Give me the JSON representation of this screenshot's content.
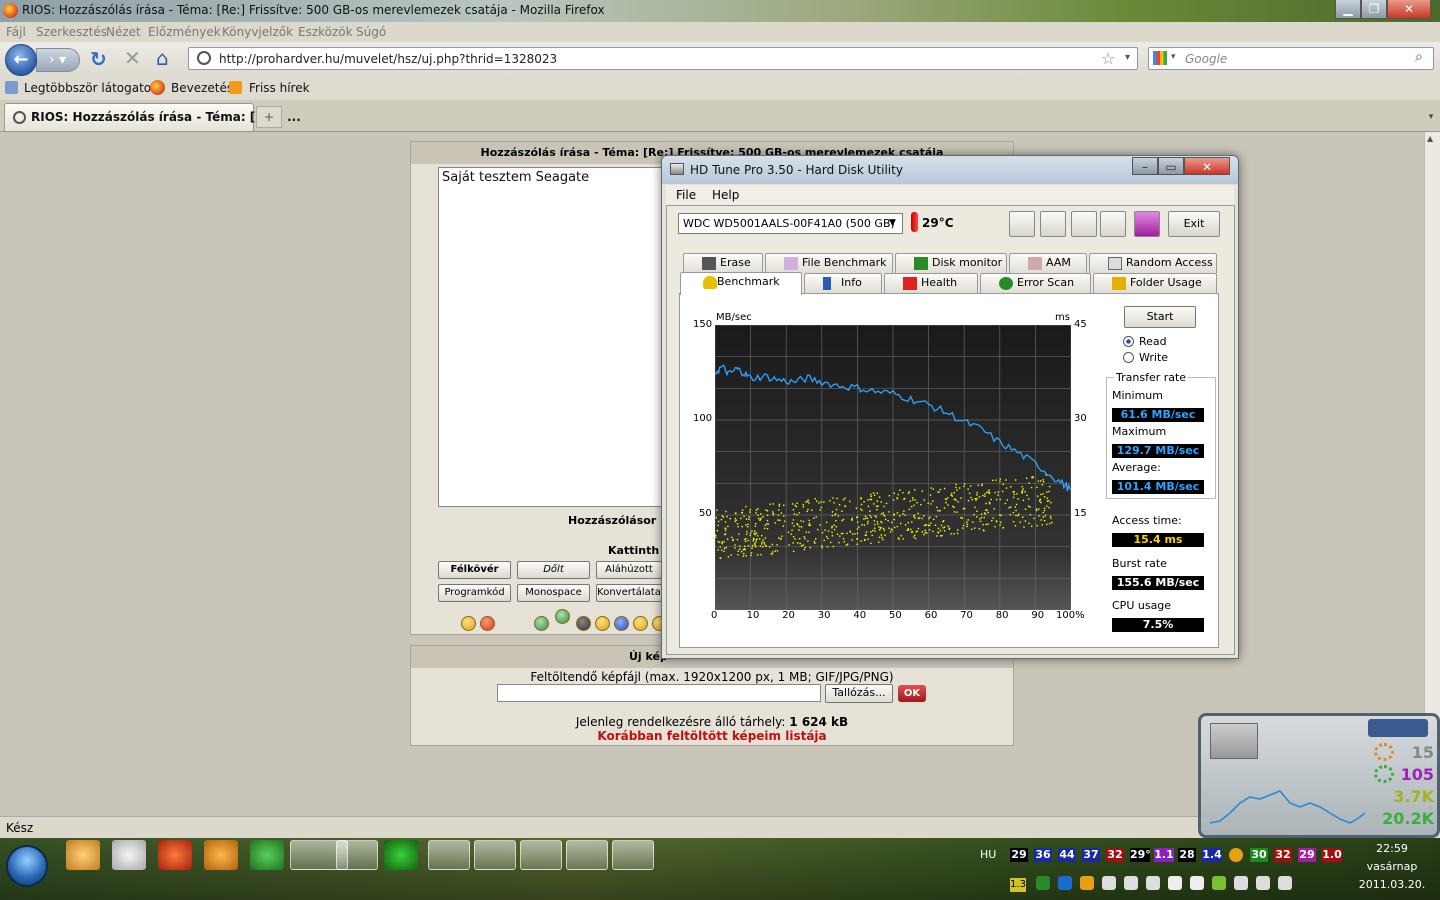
{
  "browser": {
    "title": "RIOS: Hozzászólás írása - Téma: [Re:] Frissítve: 500 GB-os merevlemezek csatája - Mozilla Firefox",
    "menu": [
      "Fájl",
      "Szerkesztés",
      "Nézet",
      "Előzmények",
      "Könyvjelzők",
      "Eszközök",
      "Súgó"
    ],
    "url": "http://prohardver.hu/muvelet/hsz/uj.php?thrid=1328023",
    "search_placeholder": "Google",
    "bookmarks": [
      "Legtöbbször látogatott",
      "Bevezetés",
      "Friss hírek"
    ],
    "tab_title": "RIOS: Hozzászólás írása - Téma: [Re:] ...",
    "status": "Kész"
  },
  "forum": {
    "header": "Hozzászólás írása - Téma: [Re:] Frissítve: 500 GB-os merevlemezek csatája",
    "text": "Saját tesztem Seagate",
    "label1": "Hozzászólásor",
    "label2": "Kattinth",
    "buttons_row1": [
      "Félkövér",
      "Dőlt",
      "Aláhúzott"
    ],
    "buttons_row2": [
      "Programkód",
      "Monospace",
      "Konvertálata"
    ],
    "upload_header": "Új kép",
    "upload_label": "Feltöltendő képfájl (max. 1920x1200 px, 1 MB; GIF/JPG/PNG)",
    "browse_button": "Tallózás...",
    "ok_button": "OK",
    "space_label": "Jelenleg rendelkezésre álló tárhely:",
    "space_value": "1 624 kB",
    "uploaded_link": "Korábban feltöltött képeim listája"
  },
  "hdtune": {
    "title": "HD Tune Pro 3.50 - Hard Disk Utility",
    "menu": [
      "File",
      "Help"
    ],
    "drive": "WDC WD5001AALS-00F41A0 (500 GB)",
    "temperature": "29°C",
    "exit_button": "Exit",
    "tabs_row1": [
      "Erase",
      "File Benchmark",
      "Disk monitor",
      "AAM",
      "Random Access"
    ],
    "tabs_row2": [
      "Benchmark",
      "Info",
      "Health",
      "Error Scan",
      "Folder Usage"
    ],
    "start_button": "Start",
    "radio_read": "Read",
    "radio_write": "Write",
    "transfer_rate": "Transfer rate",
    "minimum_label": "Minimum",
    "minimum_value": "61.6 MB/sec",
    "maximum_label": "Maximum",
    "maximum_value": "129.7 MB/sec",
    "average_label": "Average:",
    "average_value": "101.4 MB/sec",
    "access_label": "Access time:",
    "access_value": "15.4 ms",
    "burst_label": "Burst rate",
    "burst_value": "155.6 MB/sec",
    "cpu_label": "CPU usage",
    "cpu_value": "7.5%"
  },
  "chart_data": {
    "type": "line",
    "ylabel_left": "MB/sec",
    "ylabel_right": "ms",
    "ylim_left": [
      0,
      150
    ],
    "ylim_right": [
      0,
      45
    ],
    "y_ticks_left": [
      "150",
      "100",
      "50"
    ],
    "y_ticks_right": [
      "45",
      "30",
      "15"
    ],
    "x_ticks": [
      "0",
      "10",
      "20",
      "30",
      "40",
      "50",
      "60",
      "70",
      "80",
      "90",
      "100%"
    ],
    "series": [
      {
        "name": "Transfer rate",
        "unit": "MB/sec",
        "color": "#2ea3ff",
        "x": [
          0,
          2,
          4,
          6,
          8,
          10,
          14,
          18,
          22,
          26,
          30,
          35,
          40,
          45,
          50,
          55,
          60,
          65,
          70,
          75,
          80,
          85,
          90,
          95,
          98,
          100
        ],
        "values": [
          125,
          128,
          124,
          127,
          125,
          122,
          123,
          121,
          120,
          122,
          120,
          118,
          117,
          115,
          114,
          111,
          108,
          104,
          99,
          95,
          88,
          83,
          77,
          70,
          66,
          63
        ]
      },
      {
        "name": "Access time",
        "unit": "ms",
        "color": "#ffff00",
        "type": "scatter",
        "x_range": [
          0,
          95
        ],
        "values_range_start": [
          8,
          16
        ],
        "values_range_end": [
          14,
          22
        ]
      }
    ],
    "grid": true
  },
  "taskbar": {
    "lang": "HU",
    "tray_values": [
      "29",
      "36",
      "44",
      "37",
      "32",
      "29°",
      "1.1",
      "28",
      "1.4",
      "30",
      "32",
      "29",
      "1.0"
    ],
    "tray_row2_first": "1.3",
    "time": "22:59",
    "day": "vasárnap",
    "date": "2011.03.20."
  },
  "gadget": {
    "values": [
      "15",
      "105",
      "3.7K",
      "20.2K"
    ]
  }
}
